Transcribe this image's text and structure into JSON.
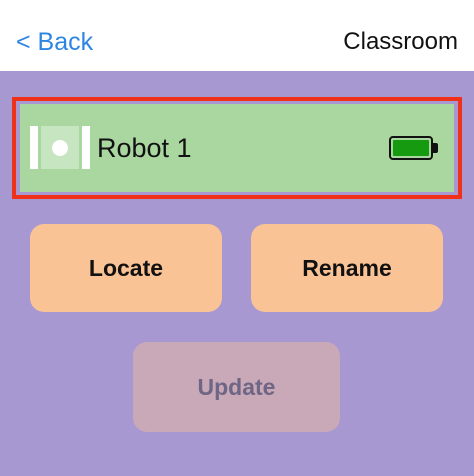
{
  "navbar": {
    "back_label": "< Back",
    "title": "Classroom"
  },
  "robot": {
    "name": "Robot 1",
    "battery_level": 1.0,
    "selected": true,
    "icon": "robot-icon"
  },
  "actions": {
    "locate_label": "Locate",
    "rename_label": "Rename",
    "update_label": "Update",
    "update_enabled": false
  },
  "colors": {
    "accent": "#2f86e2",
    "background": "#a898d2",
    "card": "#aad7a0",
    "selection": "#f0311a",
    "button": "#fac395",
    "button_disabled": "#c9a8b8",
    "battery": "#159a10"
  }
}
